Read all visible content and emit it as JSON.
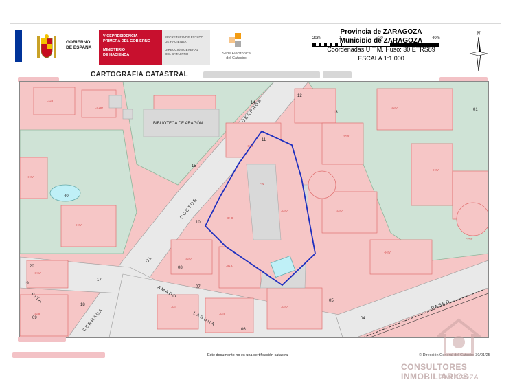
{
  "header": {
    "gov_line1": "GOBIERNO",
    "gov_line2": "DE ESPAÑA",
    "red_line1": "VICEPRESIDENCIA",
    "red_line2": "PRIMERA DEL GOBIERNO",
    "red_line3": "MINISTERIO",
    "red_line4": "DE HACIENDA",
    "gray_line1": "SECRETARÍA DE ESTADO",
    "gray_line2": "DE HACIENDA",
    "gray_line3": "DIRECCIÓN GENERAL",
    "gray_line4": "DEL CATASTRO",
    "sede_line1": "Sede Electrónica",
    "sede_line2": "del Catastro",
    "province": "Provincia de ZARAGOZA",
    "municipality": "Municipio de ZARAGOZA",
    "coords": "Coordenadas U.T.M. Huso: 30 ETRS89",
    "scale_text": "ESCALA 1:1,000",
    "scale_labels": [
      "20m",
      "0",
      "20",
      "40m"
    ],
    "north": "N"
  },
  "title": "CARTOGRAFIA CATASTRAL",
  "map": {
    "street_labels": [
      "DOCTOR",
      "CERRADA",
      "CL",
      "FITA",
      "CERRADA",
      "AMADO",
      "LAGUNA",
      "PASEO"
    ],
    "building_label": "BIBLIOTECA DE ARAGÓN",
    "parcel_numbers": [
      "14",
      "12",
      "13",
      "01",
      "11",
      "15",
      "10",
      "40",
      "20",
      "19",
      "17",
      "18",
      "09",
      "08",
      "07",
      "06",
      "05",
      "04",
      "02"
    ]
  },
  "footer": {
    "note": "Este documento no es una certificación catastral",
    "copyright": "© Dirección General del Catastro 30/01/25"
  },
  "watermark": {
    "name": "CONSULTORES INMOBILIARIOS",
    "city": "ZARAGOZA"
  },
  "colors": {
    "parcel_fill": "#f6c6c6",
    "parcel_stroke": "#e07070",
    "green_area": "#cfe3d6",
    "road": "#e9e9e9",
    "highlight": "#1e2fbf",
    "water": "#bff0f7"
  }
}
